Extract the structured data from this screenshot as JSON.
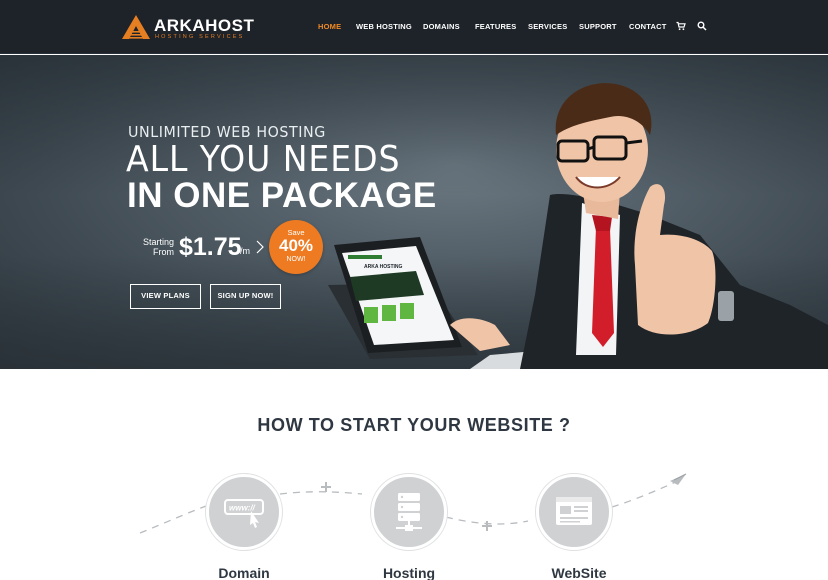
{
  "brand": {
    "name": "ARKAHOST",
    "tagline": "HOSTING SERVICES",
    "accent_color": "#f08a24",
    "header_bg": "#1e2329"
  },
  "nav": {
    "items": [
      {
        "label": "HOME",
        "active": true
      },
      {
        "label": "WEB HOSTING",
        "active": false
      },
      {
        "label": "DOMAINS",
        "active": false
      },
      {
        "label": "FEATURES",
        "active": false
      },
      {
        "label": "SERVICES",
        "active": false
      },
      {
        "label": "SUPPORT",
        "active": false
      },
      {
        "label": "CONTACT",
        "active": false
      }
    ],
    "icons": [
      "cart-icon",
      "search-icon"
    ]
  },
  "hero": {
    "kicker": "UNLIMITED WEB HOSTING",
    "line1": "ALL YOU NEEDS",
    "line2": "IN ONE PACKAGE",
    "price_prefix_line1": "Starting",
    "price_prefix_line2": "From",
    "price": "$1.75",
    "price_unit": "/m",
    "badge_top": "Save",
    "badge_value": "40%",
    "badge_bottom": "NOW!",
    "buttons": {
      "view_plans": "VIEW PLANS",
      "sign_up": "SIGN UP NOW!"
    },
    "laptop_screen_heading": "ARKA HOSTING",
    "badge_color": "#ee7b22"
  },
  "steps_section": {
    "title": "HOW TO START YOUR WEBSITE ?",
    "steps": [
      {
        "label": "Domain",
        "icon": "www-icon",
        "icon_text": "www://"
      },
      {
        "label": "Hosting",
        "icon": "server-icon"
      },
      {
        "label": "WebSite",
        "icon": "website-icon"
      }
    ]
  }
}
